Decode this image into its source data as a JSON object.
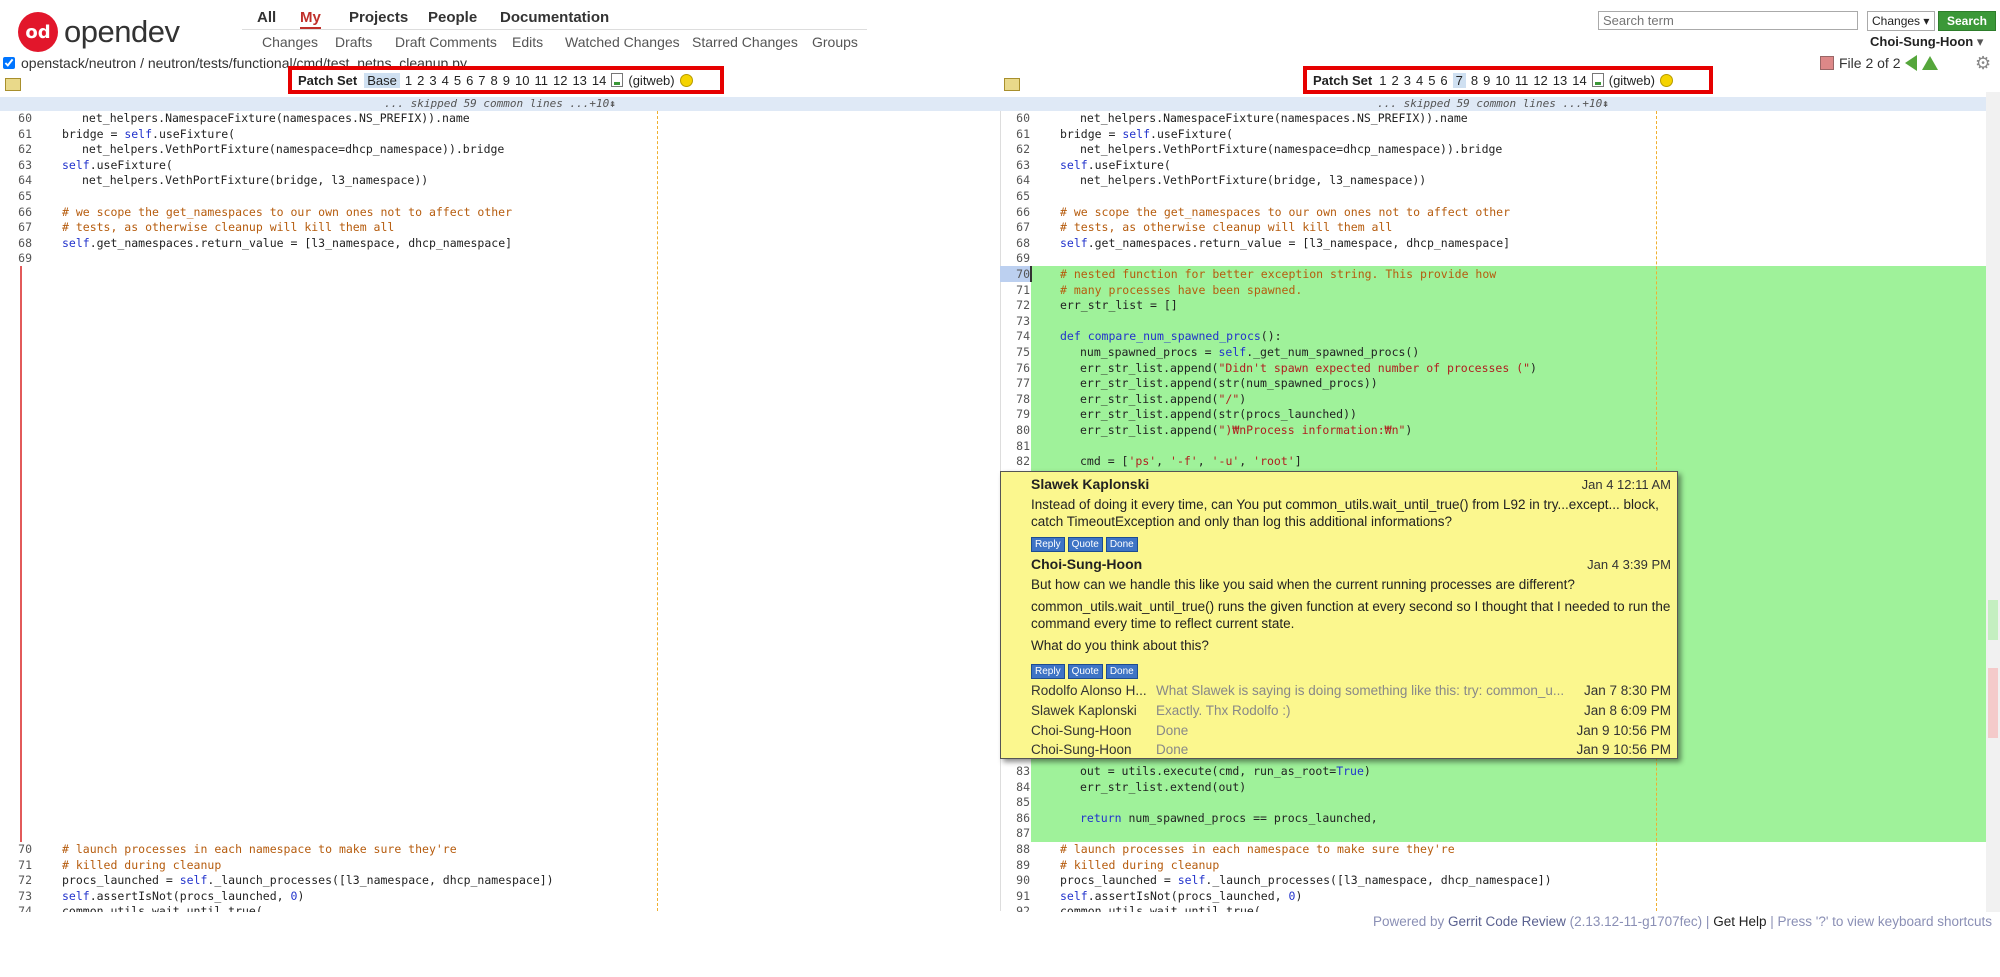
{
  "logo": {
    "mark": "od",
    "name": "opendev"
  },
  "top_nav": [
    "All",
    "My",
    "Projects",
    "People",
    "Documentation"
  ],
  "sub_nav": [
    "Changes",
    "Drafts",
    "Draft Comments",
    "Edits",
    "Watched Changes",
    "Starred Changes",
    "Groups"
  ],
  "search": {
    "placeholder": "Search term",
    "scope": "Changes",
    "button": "Search"
  },
  "user": "Choi-Sung-Hoon",
  "file_path": "openstack/neutron / neutron/tests/functional/cmd/test_netns_cleanup.py",
  "file_nav": "File 2 of 2",
  "patch_bar_left": {
    "label": "Patch Set",
    "items": [
      "Base",
      "1",
      "2",
      "3",
      "4",
      "5",
      "6",
      "7",
      "8",
      "9",
      "10",
      "11",
      "12",
      "13",
      "14"
    ],
    "selected": "Base",
    "gitweb": "(gitweb)"
  },
  "patch_bar_right": {
    "label": "Patch Set",
    "items": [
      "1",
      "2",
      "3",
      "4",
      "5",
      "6",
      "7",
      "8",
      "9",
      "10",
      "11",
      "12",
      "13",
      "14"
    ],
    "selected": "7",
    "gitweb": "(gitweb)"
  },
  "skipped_text": "... skipped 59 common lines ...+10⇞",
  "left_code_top": [
    {
      "n": "60",
      "i": 2,
      "t": [
        [
          "",
          "net_helpers.NamespaceFixture(namespaces.NS_PREFIX)).name"
        ]
      ]
    },
    {
      "n": "61",
      "i": 1,
      "t": [
        [
          "",
          "bridge = "
        ],
        [
          "kw",
          "self"
        ],
        [
          "",
          ".useFixture("
        ]
      ]
    },
    {
      "n": "62",
      "i": 2,
      "t": [
        [
          "",
          "net_helpers.VethPortFixture(namespace=dhcp_namespace)).bridge"
        ]
      ]
    },
    {
      "n": "63",
      "i": 1,
      "t": [
        [
          "kw",
          "self"
        ],
        [
          "",
          ".useFixture("
        ]
      ]
    },
    {
      "n": "64",
      "i": 2,
      "t": [
        [
          "",
          "net_helpers.VethPortFixture(bridge, l3_namespace))"
        ]
      ]
    },
    {
      "n": "65",
      "i": 1,
      "t": [
        [
          "",
          ""
        ]
      ]
    },
    {
      "n": "66",
      "i": 1,
      "t": [
        [
          "cm",
          "# we scope the get_namespaces to our own ones not to affect other"
        ]
      ]
    },
    {
      "n": "67",
      "i": 1,
      "t": [
        [
          "cm",
          "# tests, as otherwise cleanup will kill them all"
        ]
      ]
    },
    {
      "n": "68",
      "i": 1,
      "t": [
        [
          "kw",
          "self"
        ],
        [
          "",
          ".get_namespaces.return_value = [l3_namespace, dhcp_namespace]"
        ]
      ]
    },
    {
      "n": "69",
      "i": 1,
      "t": [
        [
          "",
          ""
        ]
      ]
    }
  ],
  "left_code_bottom": [
    {
      "n": "70",
      "i": 1,
      "t": [
        [
          "cm",
          "# launch processes in each namespace to make sure they're"
        ]
      ]
    },
    {
      "n": "71",
      "i": 1,
      "t": [
        [
          "cm",
          "# killed during cleanup"
        ]
      ]
    },
    {
      "n": "72",
      "i": 1,
      "t": [
        [
          "",
          "procs_launched = "
        ],
        [
          "kw",
          "self"
        ],
        [
          "",
          "._launch_processes([l3_namespace, dhcp_namespace])"
        ]
      ]
    },
    {
      "n": "73",
      "i": 1,
      "t": [
        [
          "kw",
          "self"
        ],
        [
          "",
          ".assertIsNot(procs_launched, "
        ],
        [
          "kw",
          "0"
        ],
        [
          "",
          ")"
        ]
      ]
    },
    {
      "n": "74",
      "i": 1,
      "t": [
        [
          "",
          "common_utils.wait_until_true("
        ]
      ]
    }
  ],
  "right_code_top": [
    {
      "n": "60",
      "i": 2,
      "t": [
        [
          "",
          "net_helpers.NamespaceFixture(namespaces.NS_PREFIX)).name"
        ]
      ]
    },
    {
      "n": "61",
      "i": 1,
      "t": [
        [
          "",
          "bridge = "
        ],
        [
          "kw",
          "self"
        ],
        [
          "",
          ".useFixture("
        ]
      ]
    },
    {
      "n": "62",
      "i": 2,
      "t": [
        [
          "",
          "net_helpers.VethPortFixture(namespace=dhcp_namespace)).bridge"
        ]
      ]
    },
    {
      "n": "63",
      "i": 1,
      "t": [
        [
          "kw",
          "self"
        ],
        [
          "",
          ".useFixture("
        ]
      ]
    },
    {
      "n": "64",
      "i": 2,
      "t": [
        [
          "",
          "net_helpers.VethPortFixture(bridge, l3_namespace))"
        ]
      ]
    },
    {
      "n": "65",
      "i": 1,
      "t": [
        [
          "",
          ""
        ]
      ]
    },
    {
      "n": "66",
      "i": 1,
      "t": [
        [
          "cm",
          "# we scope the get_namespaces to our own ones not to affect other"
        ]
      ]
    },
    {
      "n": "67",
      "i": 1,
      "t": [
        [
          "cm",
          "# tests, as otherwise cleanup will kill them all"
        ]
      ]
    },
    {
      "n": "68",
      "i": 1,
      "t": [
        [
          "kw",
          "self"
        ],
        [
          "",
          ".get_namespaces.return_value = [l3_namespace, dhcp_namespace]"
        ]
      ]
    },
    {
      "n": "69",
      "i": 1,
      "t": [
        [
          "",
          ""
        ]
      ]
    },
    {
      "n": "70",
      "i": 1,
      "t": [
        [
          "cm",
          "# nested function for better exception string. This provide how"
        ]
      ]
    },
    {
      "n": "71",
      "i": 1,
      "t": [
        [
          "cm",
          "# many processes have been spawned."
        ]
      ]
    },
    {
      "n": "72",
      "i": 1,
      "t": [
        [
          "",
          "err_str_list = []"
        ]
      ]
    },
    {
      "n": "73",
      "i": 1,
      "t": [
        [
          "",
          ""
        ]
      ]
    },
    {
      "n": "74",
      "i": 1,
      "t": [
        [
          "kw",
          "def "
        ],
        [
          "kw",
          "compare_num_spawned_procs"
        ],
        [
          "",
          "():"
        ]
      ]
    },
    {
      "n": "75",
      "i": 2,
      "t": [
        [
          "",
          "num_spawned_procs = "
        ],
        [
          "kw",
          "self"
        ],
        [
          "",
          "._get_num_spawned_procs()"
        ]
      ]
    },
    {
      "n": "76",
      "i": 2,
      "t": [
        [
          "",
          "err_str_list.append("
        ],
        [
          "st",
          "\"Didn't spawn expected number of processes (\""
        ],
        [
          "",
          ")"
        ]
      ]
    },
    {
      "n": "77",
      "i": 2,
      "t": [
        [
          "",
          "err_str_list.append(str(num_spawned_procs))"
        ]
      ]
    },
    {
      "n": "78",
      "i": 2,
      "t": [
        [
          "",
          "err_str_list.append("
        ],
        [
          "st",
          "\"/\""
        ],
        [
          "",
          ")"
        ]
      ]
    },
    {
      "n": "79",
      "i": 2,
      "t": [
        [
          "",
          "err_str_list.append(str(procs_launched))"
        ]
      ]
    },
    {
      "n": "80",
      "i": 2,
      "t": [
        [
          "",
          "err_str_list.append("
        ],
        [
          "st",
          "\")₩nProcess information:₩n\""
        ],
        [
          "",
          ")"
        ]
      ]
    },
    {
      "n": "81",
      "i": 1,
      "t": [
        [
          "",
          ""
        ]
      ]
    },
    {
      "n": "82",
      "i": 2,
      "t": [
        [
          "",
          "cmd = ["
        ],
        [
          "st",
          "'ps'"
        ],
        [
          "",
          ", "
        ],
        [
          "st",
          "'-f'"
        ],
        [
          "",
          ", "
        ],
        [
          "st",
          "'-u'"
        ],
        [
          "",
          ", "
        ],
        [
          "st",
          "'root'"
        ],
        [
          "",
          "]"
        ]
      ]
    }
  ],
  "right_code_bottom": [
    {
      "n": "83",
      "i": 2,
      "t": [
        [
          "",
          "out = utils.execute(cmd, run_as_root="
        ],
        [
          "kw",
          "True"
        ],
        [
          "",
          ")"
        ]
      ]
    },
    {
      "n": "84",
      "i": 2,
      "t": [
        [
          "",
          "err_str_list.extend(out)"
        ]
      ]
    },
    {
      "n": "85",
      "i": 1,
      "t": [
        [
          "",
          ""
        ]
      ]
    },
    {
      "n": "86",
      "i": 2,
      "t": [
        [
          "kw",
          "return "
        ],
        [
          "",
          "num_spawned_procs == procs_launched,"
        ]
      ]
    },
    {
      "n": "87",
      "i": 1,
      "t": [
        [
          "",
          ""
        ]
      ]
    },
    {
      "n": "88",
      "i": 1,
      "t": [
        [
          "cm",
          "# launch processes in each namespace to make sure they're"
        ]
      ]
    },
    {
      "n": "89",
      "i": 1,
      "t": [
        [
          "cm",
          "# killed during cleanup"
        ]
      ]
    },
    {
      "n": "90",
      "i": 1,
      "t": [
        [
          "",
          "procs_launched = "
        ],
        [
          "kw",
          "self"
        ],
        [
          "",
          "._launch_processes([l3_namespace, dhcp_namespace])"
        ]
      ]
    },
    {
      "n": "91",
      "i": 1,
      "t": [
        [
          "kw",
          "self"
        ],
        [
          "",
          ".assertIsNot(procs_launched, "
        ],
        [
          "kw",
          "0"
        ],
        [
          "",
          ")"
        ]
      ]
    },
    {
      "n": "92",
      "i": 1,
      "t": [
        [
          "",
          "common_utils.wait_until_true("
        ]
      ]
    }
  ],
  "comments": {
    "c1": {
      "author": "Slawek Kaplonski",
      "date": "Jan 4 12:11 AM",
      "text": "Instead of doing it every time, can You put common_utils.wait_until_true() from L92 in try...except... block, catch TimeoutException and only than log this additional informations?"
    },
    "c2": {
      "author": "Choi-Sung-Hoon",
      "date": "Jan 4 3:39 PM",
      "p1": "But how can we handle this like you said when the current running processes are different?",
      "p2": "common_utils.wait_until_true() runs the given function at every second so I thought that I needed to run the command every time to reflect current state.",
      "p3": "What do you think about this?"
    },
    "buttons": {
      "reply": "Reply",
      "quote": "Quote",
      "done": "Done"
    },
    "replies": [
      {
        "author": "Rodolfo Alonso H...",
        "msg": "What Slawek is saying is doing something like this: try: common_u...",
        "date": "Jan 7 8:30 PM"
      },
      {
        "author": "Slawek Kaplonski",
        "msg": "Exactly. Thx Rodolfo :)",
        "date": "Jan 8 6:09 PM"
      },
      {
        "author": "Choi-Sung-Hoon",
        "msg": "Done",
        "date": "Jan 9 10:56 PM"
      },
      {
        "author": "Choi-Sung-Hoon",
        "msg": "Done",
        "date": "Jan 9 10:56 PM"
      }
    ]
  },
  "footer": {
    "powered": "Powered by ",
    "product": "Gerrit Code Review",
    "version": " (2.13.12-11-g1707fec) | ",
    "help": "Get Help",
    "shortcut": " | Press '?' to view keyboard shortcuts"
  },
  "colors": {
    "accent": "#c0302b",
    "added": "#9ff29a",
    "popup": "#fbf78e",
    "search_button": "#3b9838"
  }
}
